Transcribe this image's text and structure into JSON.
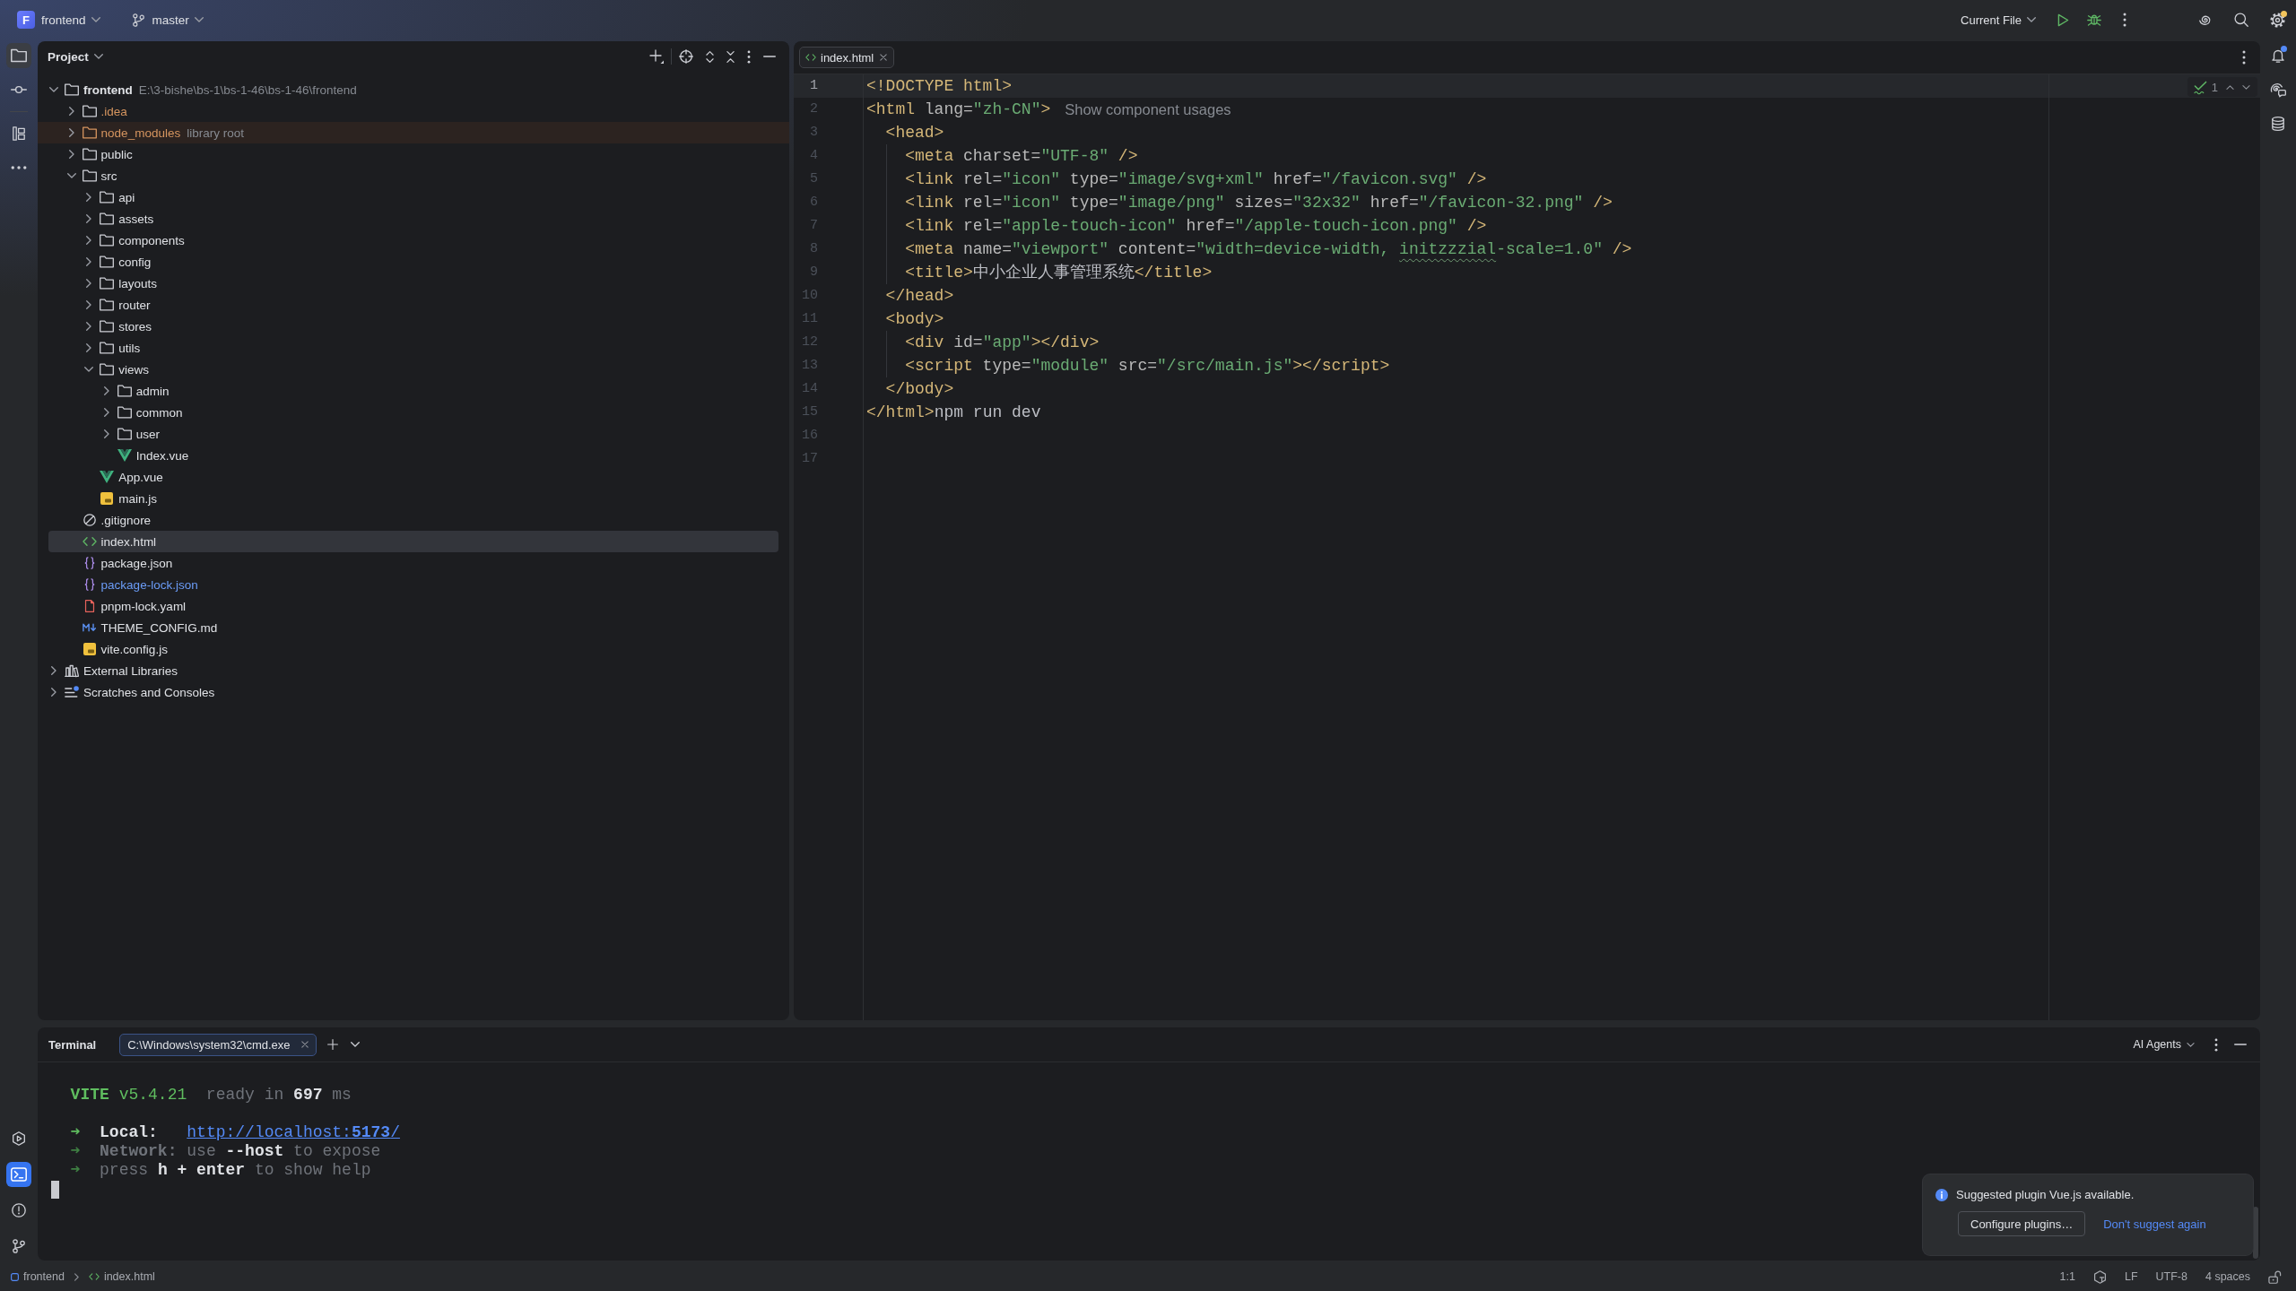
{
  "title_bar": {
    "project": {
      "initial": "F",
      "name": "frontend"
    },
    "branch": "master",
    "run_config": "Current File",
    "settings": {
      "badge": true
    }
  },
  "left_toolbar": {
    "top": [
      [
        {
          "kind": "project",
          "selected": true,
          "focused": false
        },
        {
          "kind": "commit",
          "selected": false,
          "focused": false
        }
      ],
      [
        {
          "kind": "structure",
          "selected": false,
          "focused": false
        },
        {
          "kind": "more",
          "selected": false,
          "focused": false
        }
      ]
    ],
    "bottom": [
      {
        "kind": "services",
        "selected": false,
        "focused": false
      },
      {
        "kind": "terminal",
        "selected": true,
        "focused": true
      },
      {
        "kind": "problems",
        "selected": false,
        "focused": false
      },
      {
        "kind": "git",
        "selected": false,
        "focused": false
      }
    ]
  },
  "right_toolbar": [
    {
      "kind": "notifications",
      "selected": false,
      "focused": false,
      "badge": true
    },
    {
      "kind": "assistant",
      "selected": false,
      "focused": false,
      "badge": false
    },
    {
      "kind": "database",
      "selected": false,
      "focused": false,
      "badge": false
    }
  ],
  "project_panel": {
    "title": "Project",
    "tree": [
      {
        "name": "frontend",
        "kind": "module",
        "path": "E:\\3-bishe\\bs-1\\bs-1-46\\bs-1-46\\frontend",
        "expanded": true,
        "selected": false,
        "children": [
          {
            "name": ".idea",
            "kind": "folder",
            "ignored": true,
            "excluded": false,
            "modified": false,
            "expanded": false,
            "selected": false
          },
          {
            "name": "node_modules",
            "kind": "folder",
            "ignored": true,
            "excluded": true,
            "modified": false,
            "note": "library root",
            "expanded": false,
            "selected": false
          },
          {
            "name": "public",
            "kind": "folder",
            "ignored": false,
            "excluded": false,
            "modified": false,
            "expanded": false,
            "selected": false
          },
          {
            "name": "src",
            "kind": "folder",
            "ignored": false,
            "excluded": false,
            "modified": false,
            "expanded": true,
            "selected": false,
            "children": [
              {
                "name": "api",
                "kind": "folder",
                "expanded": false,
                "selected": false
              },
              {
                "name": "assets",
                "kind": "folder",
                "expanded": false,
                "selected": false
              },
              {
                "name": "components",
                "kind": "folder",
                "expanded": false,
                "selected": false
              },
              {
                "name": "config",
                "kind": "folder",
                "expanded": false,
                "selected": false
              },
              {
                "name": "layouts",
                "kind": "folder",
                "expanded": false,
                "selected": false
              },
              {
                "name": "router",
                "kind": "folder",
                "expanded": false,
                "selected": false
              },
              {
                "name": "stores",
                "kind": "folder",
                "expanded": false,
                "selected": false
              },
              {
                "name": "utils",
                "kind": "folder",
                "expanded": false,
                "selected": false
              },
              {
                "name": "views",
                "kind": "folder",
                "expanded": true,
                "selected": false,
                "children": [
                  {
                    "name": "admin",
                    "kind": "folder",
                    "expanded": false,
                    "selected": false
                  },
                  {
                    "name": "common",
                    "kind": "folder",
                    "expanded": false,
                    "selected": false
                  },
                  {
                    "name": "user",
                    "kind": "folder",
                    "expanded": false,
                    "selected": false
                  },
                  {
                    "name": "Index.vue",
                    "kind": "vue",
                    "selected": false
                  }
                ]
              },
              {
                "name": "App.vue",
                "kind": "vue",
                "selected": false
              },
              {
                "name": "main.js",
                "kind": "js",
                "selected": false
              }
            ]
          },
          {
            "name": ".gitignore",
            "kind": "ignore",
            "ignored": false,
            "excluded": false,
            "modified": false,
            "selected": false
          },
          {
            "name": "index.html",
            "kind": "html",
            "ignored": false,
            "excluded": false,
            "modified": false,
            "selected": true
          },
          {
            "name": "package.json",
            "kind": "json",
            "ignored": false,
            "excluded": false,
            "modified": false,
            "selected": false
          },
          {
            "name": "package-lock.json",
            "kind": "json",
            "ignored": false,
            "excluded": false,
            "modified": true,
            "selected": false
          },
          {
            "name": "pnpm-lock.yaml",
            "kind": "yaml",
            "ignored": false,
            "excluded": false,
            "modified": false,
            "selected": false
          },
          {
            "name": "THEME_CONFIG.md",
            "kind": "md",
            "ignored": false,
            "excluded": false,
            "modified": false,
            "selected": false
          },
          {
            "name": "vite.config.js",
            "kind": "js",
            "ignored": false,
            "excluded": false,
            "modified": false,
            "selected": false
          }
        ]
      },
      {
        "name": "External Libraries",
        "kind": "libraries",
        "expanded": false,
        "selected": false
      },
      {
        "name": "Scratches and Consoles",
        "kind": "scratches",
        "expanded": false,
        "selected": false
      }
    ]
  },
  "editor": {
    "tabs": [
      {
        "label": "index.html",
        "kind": "html",
        "selected": true
      }
    ],
    "inspection_count": "1",
    "lines": [
      {
        "number": "1",
        "current": true,
        "tokens": [
          {
            "kind": "tag",
            "text": "<!DOCTYPE html>"
          }
        ]
      },
      {
        "number": "2",
        "current": false,
        "tokens": [
          {
            "kind": "tag",
            "text": "<html"
          },
          {
            "kind": "attr",
            "text": " lang="
          },
          {
            "kind": "value",
            "text": "\"zh-CN\""
          },
          {
            "kind": "tag",
            "text": ">"
          }
        ],
        "hint": "Show component usages"
      },
      {
        "number": "3",
        "current": false,
        "tokens": [
          {
            "kind": "tag",
            "text": "  <head>"
          }
        ]
      },
      {
        "number": "4",
        "current": false,
        "tokens": [
          {
            "kind": "tag",
            "text": "    <meta"
          },
          {
            "kind": "attr",
            "text": " charset="
          },
          {
            "kind": "value",
            "text": "\"UTF-8\""
          },
          {
            "kind": "tag",
            "text": " />"
          }
        ]
      },
      {
        "number": "5",
        "current": false,
        "tokens": [
          {
            "kind": "tag",
            "text": "    <link"
          },
          {
            "kind": "attr",
            "text": " rel="
          },
          {
            "kind": "value",
            "text": "\"icon\""
          },
          {
            "kind": "attr",
            "text": " type="
          },
          {
            "kind": "value",
            "text": "\"image/svg+xml\""
          },
          {
            "kind": "attr",
            "text": " href="
          },
          {
            "kind": "value",
            "text": "\"/favicon.svg\""
          },
          {
            "kind": "tag",
            "text": " />"
          }
        ]
      },
      {
        "number": "6",
        "current": false,
        "tokens": [
          {
            "kind": "tag",
            "text": "    <link"
          },
          {
            "kind": "attr",
            "text": " rel="
          },
          {
            "kind": "value",
            "text": "\"icon\""
          },
          {
            "kind": "attr",
            "text": " type="
          },
          {
            "kind": "value",
            "text": "\"image/png\""
          },
          {
            "kind": "attr",
            "text": " sizes="
          },
          {
            "kind": "value",
            "text": "\"32x32\""
          },
          {
            "kind": "attr",
            "text": " href="
          },
          {
            "kind": "value",
            "text": "\"/favicon-32.png\""
          },
          {
            "kind": "tag",
            "text": " />"
          }
        ]
      },
      {
        "number": "7",
        "current": false,
        "tokens": [
          {
            "kind": "tag",
            "text": "    <link"
          },
          {
            "kind": "attr",
            "text": " rel="
          },
          {
            "kind": "value",
            "text": "\"apple-touch-icon\""
          },
          {
            "kind": "attr",
            "text": " href="
          },
          {
            "kind": "value",
            "text": "\"/apple-touch-icon.png\""
          },
          {
            "kind": "tag",
            "text": " />"
          }
        ]
      },
      {
        "number": "8",
        "current": false,
        "tokens": [
          {
            "kind": "tag",
            "text": "    <meta"
          },
          {
            "kind": "attr",
            "text": " name="
          },
          {
            "kind": "value",
            "text": "\"viewport\""
          },
          {
            "kind": "attr",
            "text": " content="
          },
          {
            "kind": "value",
            "text": "\"width=device-width, "
          },
          {
            "kind": "misspelled",
            "text": "initzzzial"
          },
          {
            "kind": "value",
            "text": "-scale=1.0\""
          },
          {
            "kind": "tag",
            "text": " />"
          }
        ]
      },
      {
        "number": "9",
        "current": false,
        "tokens": [
          {
            "kind": "tag",
            "text": "    <title>"
          },
          {
            "kind": "text",
            "text": "中小企业人事管理系统"
          },
          {
            "kind": "tag",
            "text": "</title>"
          }
        ]
      },
      {
        "number": "10",
        "current": false,
        "tokens": [
          {
            "kind": "tag",
            "text": "  </head>"
          }
        ]
      },
      {
        "number": "11",
        "current": false,
        "tokens": [
          {
            "kind": "tag",
            "text": "  <body>"
          }
        ]
      },
      {
        "number": "12",
        "current": false,
        "tokens": [
          {
            "kind": "tag",
            "text": "    <div"
          },
          {
            "kind": "attr",
            "text": " id="
          },
          {
            "kind": "value",
            "text": "\"app\""
          },
          {
            "kind": "tag",
            "text": "></div>"
          }
        ]
      },
      {
        "number": "13",
        "current": false,
        "tokens": [
          {
            "kind": "tag",
            "text": "    <script"
          },
          {
            "kind": "attr",
            "text": " type="
          },
          {
            "kind": "value",
            "text": "\"module\""
          },
          {
            "kind": "attr",
            "text": " src="
          },
          {
            "kind": "value",
            "text": "\"/src/main.js\""
          },
          {
            "kind": "tag",
            "text": "></script>"
          }
        ]
      },
      {
        "number": "14",
        "current": false,
        "tokens": [
          {
            "kind": "tag",
            "text": "  </body>"
          }
        ]
      },
      {
        "number": "15",
        "current": false,
        "tokens": [
          {
            "kind": "tag",
            "text": "</html>"
          },
          {
            "kind": "text",
            "text": "npm run dev"
          }
        ]
      },
      {
        "number": "16",
        "current": false
      },
      {
        "number": "17",
        "current": false
      }
    ]
  },
  "terminal": {
    "title": "Terminal",
    "tabs": [
      {
        "label": "C:\\Windows\\system32\\cmd.exe",
        "selected": true
      }
    ],
    "agents": "AI Agents",
    "output": [
      {
        "lines": [
          {
            "tokens": [
              {
                "kind": "brand",
                "text": "  VITE"
              },
              {
                "kind": "accent",
                "text": " v5.4.21"
              },
              {
                "kind": "muted",
                "text": "  ready in "
              },
              {
                "kind": "strong",
                "text": "697"
              },
              {
                "kind": "muted",
                "text": " ms"
              }
            ]
          }
        ]
      },
      {
        "lines": [
          {
            "tokens": [
              {
                "kind": "arrow",
                "text": "  ➜"
              },
              {
                "kind": "label",
                "text": "  Local:   "
              },
              {
                "kind": "link",
                "text": "http://localhost:**5173**/"
              }
            ]
          },
          {
            "tokens": [
              {
                "kind": "dimarrow",
                "text": "  ➜"
              },
              {
                "kind": "dimlabel",
                "text": "  Network:"
              },
              {
                "kind": "muted",
                "text": " use "
              },
              {
                "kind": "strong",
                "text": "--host"
              },
              {
                "kind": "muted",
                "text": " to expose"
              }
            ]
          },
          {
            "tokens": [
              {
                "kind": "dimarrow",
                "text": "  ➜"
              },
              {
                "kind": "muted",
                "text": "  press "
              },
              {
                "kind": "strong",
                "text": "h + enter"
              },
              {
                "kind": "muted",
                "text": " to show help"
              }
            ]
          }
        ]
      }
    ]
  },
  "notification": {
    "message": "Suggested plugin Vue.js available.",
    "actions": [
      {
        "kind": "button",
        "label": "Configure plugins…"
      },
      {
        "kind": "link",
        "label": "Don't suggest again"
      }
    ]
  },
  "status_bar": {
    "breadcrumbs": [
      {
        "kind": "module",
        "label": "frontend"
      },
      {
        "kind": "html",
        "label": "index.html"
      }
    ],
    "caret": "1:1",
    "line_separator": "LF",
    "encoding": "UTF-8",
    "indentation": "4 spaces"
  }
}
